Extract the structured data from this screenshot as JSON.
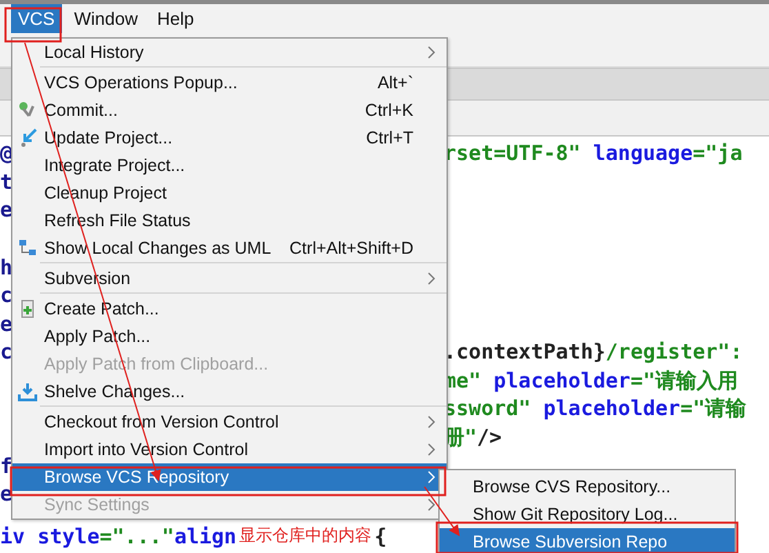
{
  "menubar": [
    {
      "label": "VCS",
      "selected": true
    },
    {
      "label": "Window",
      "selected": false
    },
    {
      "label": "Help",
      "selected": false
    }
  ],
  "editor": {
    "lines": [
      {
        "kind": "code",
        "left": "@",
        "right": [
          {
            "text": "rset=UTF-8\"",
            "kind": "string"
          },
          {
            "text": " language",
            "kind": "attr"
          },
          {
            "text": "=\"ja",
            "kind": "string"
          }
        ]
      },
      {
        "kind": "code",
        "left": "t"
      },
      {
        "kind": "code",
        "left": "e"
      },
      {
        "kind": "blank"
      },
      {
        "kind": "code",
        "left": "h"
      },
      {
        "kind": "code",
        "left": "c"
      },
      {
        "kind": "code",
        "left": "e"
      },
      {
        "kind": "code",
        "left": "c",
        "right": [
          {
            "text": ".contextPath}",
            "kind": "plain"
          },
          {
            "text": "/register\":",
            "kind": "string"
          }
        ]
      },
      {
        "kind": "code",
        "right": [
          {
            "text": "me\"",
            "kind": "string"
          },
          {
            "text": " placeholder",
            "kind": "attr"
          },
          {
            "text": "=\"请输入用",
            "kind": "string"
          }
        ]
      },
      {
        "kind": "code",
        "right": [
          {
            "text": "ssword\"",
            "kind": "string"
          },
          {
            "text": " placeholder",
            "kind": "attr"
          },
          {
            "text": "=\"请输",
            "kind": "string"
          }
        ]
      },
      {
        "kind": "code",
        "right": [
          {
            "text": "册\"",
            "kind": "string"
          },
          {
            "text": "/>",
            "kind": "plain"
          }
        ]
      },
      {
        "kind": "code",
        "left": "f"
      },
      {
        "kind": "code",
        "left": "e"
      }
    ],
    "last_line": [
      {
        "text": "iv style",
        "kind": "attr"
      },
      {
        "text": "=\"...\"",
        "kind": "string"
      },
      {
        "text": " align",
        "kind": "attr"
      }
    ],
    "last_line_tail": "{"
  },
  "menu": {
    "items": [
      {
        "kind": "item",
        "label": "Local History",
        "submenu": true,
        "disabled": false,
        "selected": false
      },
      {
        "kind": "separator"
      },
      {
        "kind": "item",
        "label": "VCS Operations Popup...",
        "shortcut": "Alt+`",
        "submenu": false,
        "disabled": false,
        "selected": false
      },
      {
        "kind": "item",
        "label": "Commit...",
        "shortcut": "Ctrl+K",
        "submenu": false,
        "disabled": false,
        "selected": false
      },
      {
        "kind": "item",
        "label": "Update Project...",
        "shortcut": "Ctrl+T",
        "submenu": false,
        "disabled": false,
        "selected": false
      },
      {
        "kind": "item",
        "label": "Integrate Project...",
        "submenu": false,
        "disabled": false,
        "selected": false
      },
      {
        "kind": "item",
        "label": "Cleanup Project",
        "submenu": false,
        "disabled": false,
        "selected": false
      },
      {
        "kind": "item",
        "label": "Refresh File Status",
        "submenu": false,
        "disabled": false,
        "selected": false
      },
      {
        "kind": "item",
        "label": "Show Local Changes as UML",
        "shortcut": "Ctrl+Alt+Shift+D",
        "submenu": false,
        "disabled": false,
        "selected": false
      },
      {
        "kind": "separator"
      },
      {
        "kind": "item",
        "label": "Subversion",
        "submenu": true,
        "disabled": false,
        "selected": false
      },
      {
        "kind": "separator"
      },
      {
        "kind": "item",
        "label": "Create Patch...",
        "submenu": false,
        "disabled": false,
        "selected": false
      },
      {
        "kind": "item",
        "label": "Apply Patch...",
        "submenu": false,
        "disabled": false,
        "selected": false
      },
      {
        "kind": "item",
        "label": "Apply Patch from Clipboard...",
        "submenu": false,
        "disabled": true,
        "selected": false
      },
      {
        "kind": "item",
        "label": "Shelve Changes...",
        "submenu": false,
        "disabled": false,
        "selected": false
      },
      {
        "kind": "separator"
      },
      {
        "kind": "item",
        "label": "Checkout from Version Control",
        "submenu": true,
        "disabled": false,
        "selected": false
      },
      {
        "kind": "item",
        "label": "Import into Version Control",
        "submenu": true,
        "disabled": false,
        "selected": false
      },
      {
        "kind": "item",
        "label": "Browse VCS Repository",
        "submenu": true,
        "disabled": false,
        "selected": true
      },
      {
        "kind": "item",
        "label": "Sync Settings",
        "submenu": true,
        "disabled": true,
        "selected": false
      }
    ]
  },
  "submenu": {
    "items": [
      {
        "label": "Browse CVS Repository...",
        "selected": false
      },
      {
        "label": "Show Git Repository Log...",
        "selected": false
      },
      {
        "label": "Browse Subversion Repo",
        "selected": true
      }
    ]
  },
  "annotation": {
    "text": "显示仓库中的内容"
  }
}
